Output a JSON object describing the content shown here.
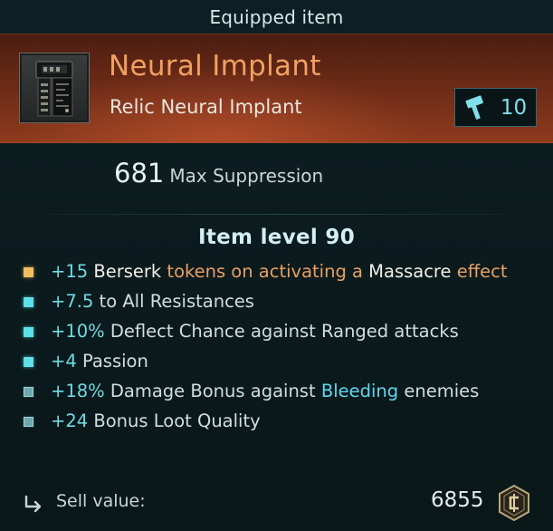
{
  "header": {
    "title": "Equipped item"
  },
  "item": {
    "name": "Neural Implant",
    "type": "Relic Neural Implant",
    "rarity_color": "#f0a060",
    "thumbnail_icon": "neural-implant-icon",
    "requirement": {
      "icon": "hammer-icon",
      "value": "10"
    }
  },
  "primary_stat": {
    "value": "681",
    "label": "Max Suppression"
  },
  "item_level": "Item level 90",
  "affixes": [
    {
      "bullet": "gold",
      "parts": [
        "+15",
        " ",
        "Berserk",
        " tokens on activating a ",
        "Massacre",
        " effect"
      ]
    },
    {
      "bullet": "cyan",
      "parts": [
        "+7.5",
        " to All Resistances"
      ]
    },
    {
      "bullet": "cyan",
      "parts": [
        "+10%",
        " Deflect Chance against Ranged attacks"
      ]
    },
    {
      "bullet": "cyan",
      "parts": [
        "+4",
        " Passion"
      ]
    },
    {
      "bullet": "dim",
      "parts": [
        "+18%",
        " Damage Bonus against ",
        "Bleeding",
        " enemies"
      ]
    },
    {
      "bullet": "dim",
      "parts": [
        "+24",
        " Bonus Loot Quality"
      ]
    }
  ],
  "sell": {
    "icon": "sell-arrow-icon",
    "label": "Sell value:",
    "value": "6855",
    "currency_icon": "coin-icon"
  },
  "colors": {
    "accent": "#6fdce4",
    "banner": "#8d3a1d",
    "gold_bullet": "#f0c060"
  }
}
